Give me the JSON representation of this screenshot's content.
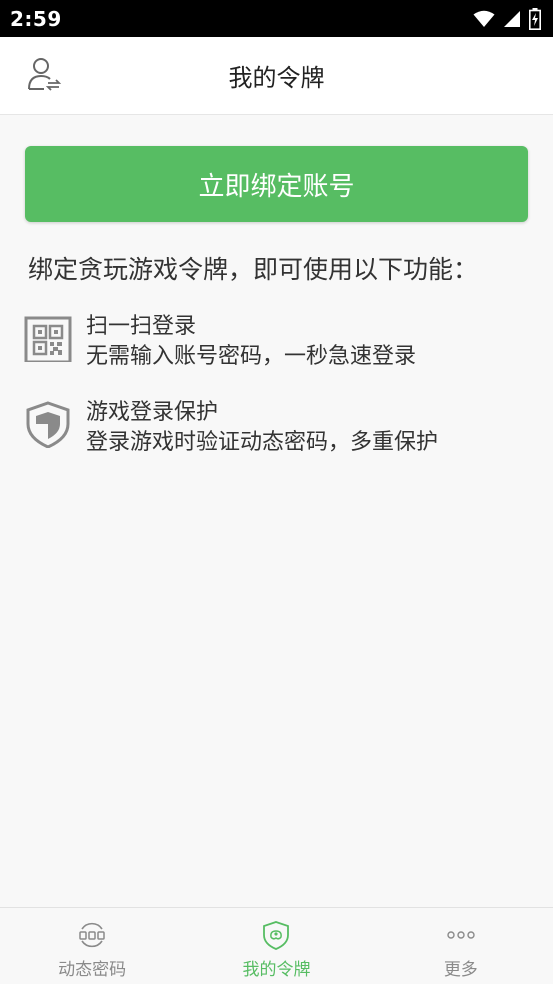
{
  "status_bar": {
    "time": "2:59",
    "icons": [
      "wifi-icon",
      "signal-icon",
      "battery-charging-icon"
    ]
  },
  "app_bar": {
    "title": "我的令牌",
    "left_icon": "user-switch-icon"
  },
  "main": {
    "bind_button_label": "立即绑定账号",
    "intro": "绑定贪玩游戏令牌，即可使用以下功能：",
    "features": [
      {
        "icon": "qr-code-icon",
        "title": "扫一扫登录",
        "desc": "无需输入账号密码，一秒急速登录"
      },
      {
        "icon": "shield-icon",
        "title": "游戏登录保护",
        "desc": "登录游戏时验证动态密码，多重保护"
      }
    ]
  },
  "bottom_nav": {
    "items": [
      {
        "icon": "dynamic-password-icon",
        "label": "动态密码",
        "active": false
      },
      {
        "icon": "my-token-shield-icon",
        "label": "我的令牌",
        "active": true
      },
      {
        "icon": "more-dots-icon",
        "label": "更多",
        "active": false
      }
    ]
  },
  "colors": {
    "accent": "#57bd63",
    "status_bar": "#000000",
    "background": "#f8f8f8",
    "icon_gray": "#8a8a8a"
  }
}
